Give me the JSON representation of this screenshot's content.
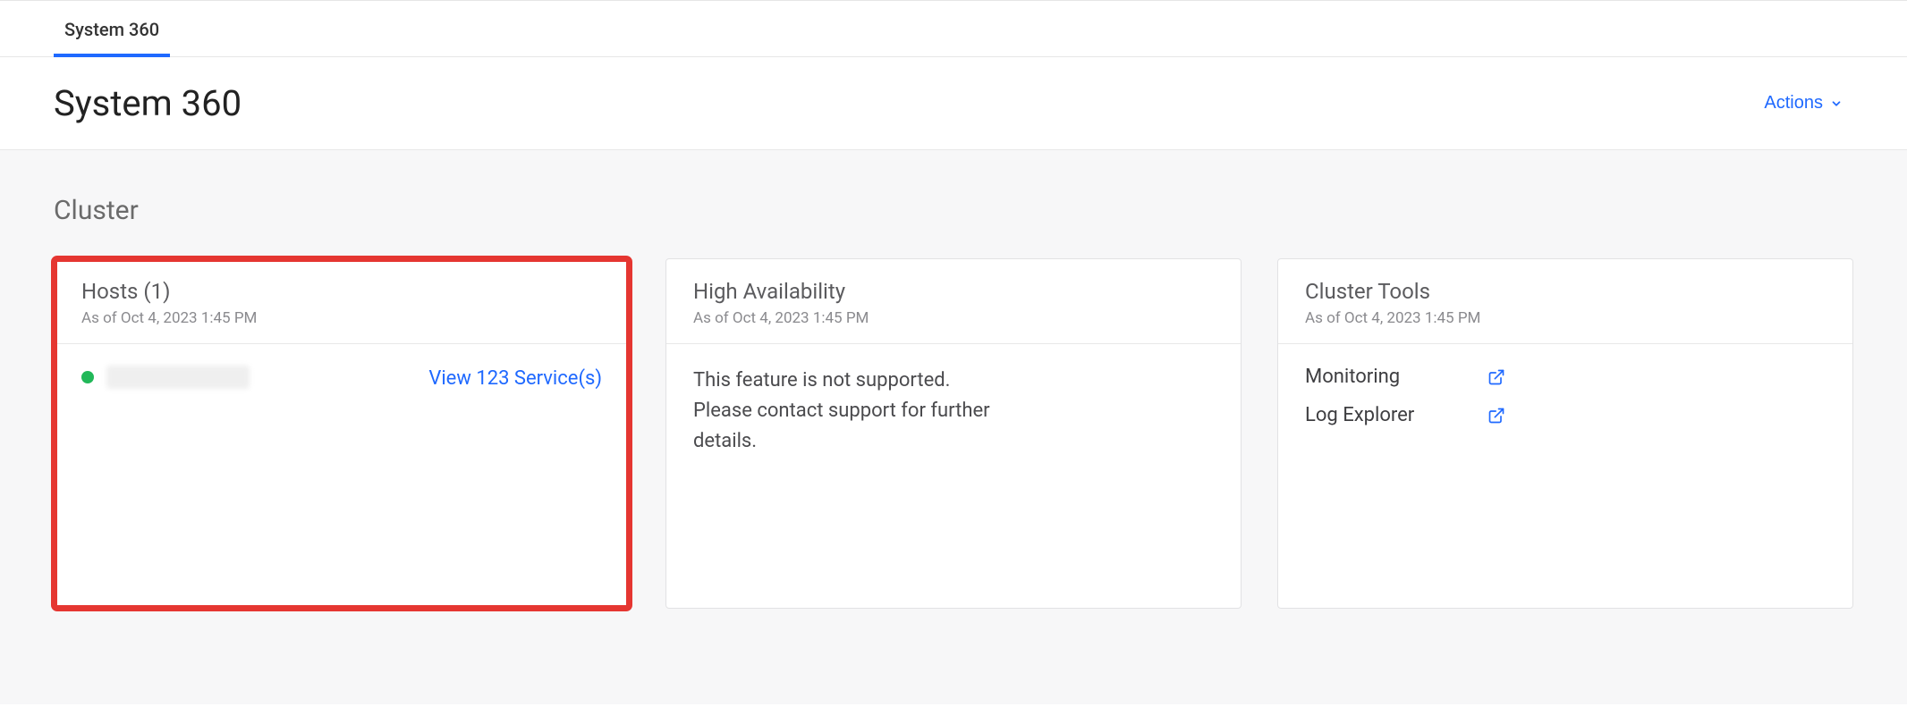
{
  "tabs": {
    "system360": "System 360"
  },
  "header": {
    "title": "System 360",
    "actions_label": "Actions"
  },
  "cluster": {
    "section_title": "Cluster",
    "hosts": {
      "title": "Hosts (1)",
      "timestamp": "As of Oct 4, 2023 1:45 PM",
      "view_link": "View 123 Service(s)",
      "status": "healthy"
    },
    "ha": {
      "title": "High Availability",
      "timestamp": "As of Oct 4, 2023 1:45 PM",
      "message": "This feature is not supported. Please contact support for further details."
    },
    "tools": {
      "title": "Cluster Tools",
      "timestamp": "As of Oct 4, 2023 1:45 PM",
      "monitoring_label": "Monitoring",
      "log_explorer_label": "Log Explorer"
    }
  },
  "colors": {
    "accent": "#1f69ff",
    "highlight_border": "#e53631",
    "status_green": "#22b859"
  }
}
